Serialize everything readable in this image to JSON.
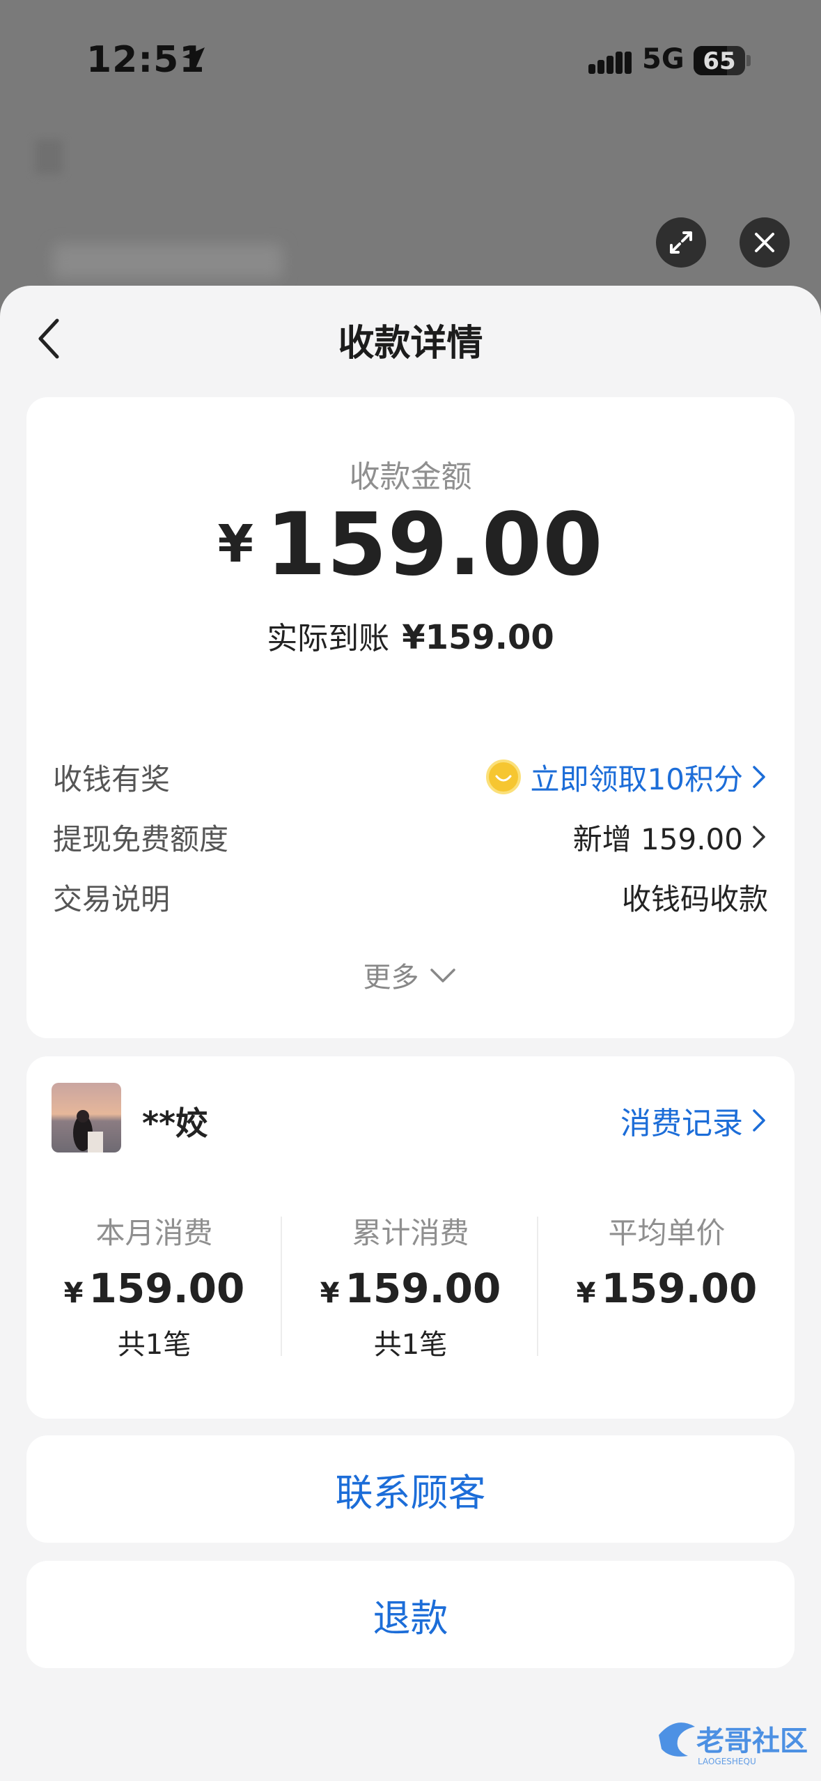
{
  "status_bar": {
    "time": "12:51",
    "network": "5G",
    "battery": "65",
    "battery_level": 0.65
  },
  "header": {
    "title": "收款详情"
  },
  "payment": {
    "amount_label": "收款金额",
    "currency_symbol": "¥",
    "amount": "159.00",
    "actual_label": "实际到账",
    "actual_value": "¥159.00"
  },
  "details": [
    {
      "label": "收钱有奖",
      "value": "立即领取10积分"
    },
    {
      "label": "提现免费额度",
      "value": "新增 159.00"
    },
    {
      "label": "交易说明",
      "value": "收钱码收款"
    }
  ],
  "more_label": "更多",
  "customer": {
    "name": "**姣",
    "records_link": "消费记录",
    "stats": [
      {
        "label": "本月消费",
        "symbol": "¥",
        "value": "159.00",
        "sub": "共1笔"
      },
      {
        "label": "累计消费",
        "symbol": "¥",
        "value": "159.00",
        "sub": "共1笔"
      },
      {
        "label": "平均单价",
        "symbol": "¥",
        "value": "159.00",
        "sub": ""
      }
    ]
  },
  "actions": {
    "contact": "联系顾客",
    "refund": "退款"
  },
  "watermark": {
    "text": "老哥社区",
    "subtext": "LAOGESHEQU"
  },
  "colors": {
    "accent": "#1c6dd8",
    "sheet_bg": "#f4f4f5",
    "backdrop": "#7a7a7a"
  }
}
